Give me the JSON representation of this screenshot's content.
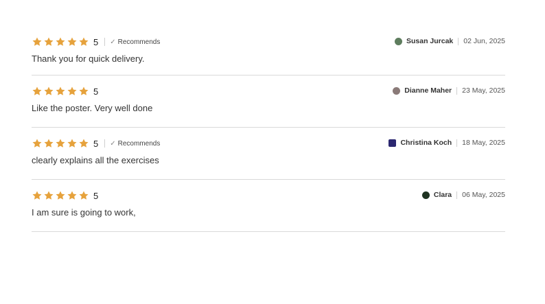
{
  "reviews": [
    {
      "rating": 5,
      "score_label": "5",
      "recommends": true,
      "recommends_label": "Recommends",
      "comment": "Thank you for quick delivery.",
      "author": "Susan Jurcak",
      "date": "02 Jun, 2025",
      "avatar_color": "#5e7d5e",
      "avatar_shape": "circle"
    },
    {
      "rating": 5,
      "score_label": "5",
      "recommends": false,
      "comment": "Like the poster. Very well done",
      "author": "Dianne Maher",
      "date": "23 May, 2025",
      "avatar_color": "#8a7a78",
      "avatar_shape": "circle"
    },
    {
      "rating": 5,
      "score_label": "5",
      "recommends": true,
      "recommends_label": "Recommends",
      "comment": "clearly explains all the exercises",
      "author": "Christina Koch",
      "date": "18 May, 2025",
      "avatar_color": "#2b2770",
      "avatar_shape": "square"
    },
    {
      "rating": 5,
      "score_label": "5",
      "recommends": false,
      "comment": "I am sure is going to work,",
      "author": "Clara",
      "date": "06 May, 2025",
      "avatar_color": "#1f3322",
      "avatar_shape": "circle"
    }
  ],
  "colors": {
    "star": "#e6a23c",
    "divider": "#d9d9d9"
  },
  "icons": {
    "star": "star-icon",
    "check": "check-icon"
  }
}
